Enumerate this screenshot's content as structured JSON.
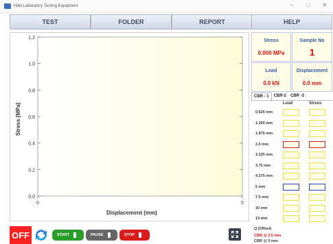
{
  "window": {
    "title": "Hitel Laboratory Testing Equipment",
    "min": "–",
    "max": "□",
    "close": "✕"
  },
  "menu": {
    "test": "TEST",
    "folder": "FOLDER",
    "report": "REPORT",
    "help": "HELP"
  },
  "stats": {
    "stress_label": "Stress",
    "stress_value": "0.000 MPa",
    "sample_label": "Sample No",
    "sample_value": "1",
    "load_label": "Load",
    "load_value": "0.0 kN",
    "disp_label": "Displacement",
    "disp_value": "0.0 mm"
  },
  "tabs": [
    "CBR - 1",
    "CBR-2",
    "CBR -3"
  ],
  "table": {
    "load_header": "Load",
    "stress_header": "Stress",
    "rows": [
      "0.625 mm",
      "1.250 mm",
      "1.875 mm",
      "2.5 mm",
      "3.125 mm",
      "3.75 mm",
      "4.375 mm",
      "5 mm",
      "7.5 mm",
      "10 mm",
      "13 mm"
    ]
  },
  "summary": {
    "q_offset": "Q (Offset)",
    "cbr_25": "CBR @ 2.5 mm",
    "cbr_5": "CBR @ 5 mm"
  },
  "controls": {
    "off": "OFF",
    "start": "START",
    "pause": "PAUSE",
    "stop": "STOP"
  },
  "colors": {
    "accent_red": "#e01010",
    "menu_text": "#3d4a66",
    "start_green": "#2a9d2a",
    "stop_red": "#d81c1c"
  },
  "icons": {
    "sync": "sync-icon",
    "expand": "expand-icon"
  },
  "chart_data": {
    "type": "line",
    "xlabel": "Displacement (mm)",
    "ylabel": "Stress (MPa)",
    "xlim": [
      0,
      5
    ],
    "ylim": [
      0,
      1.2
    ],
    "x_ticks": [
      "0",
      "5"
    ],
    "y_ticks": [
      "0,0",
      "0,2",
      "0,4",
      "0,6",
      "0,8",
      "1,0",
      "1,2"
    ],
    "series": []
  }
}
